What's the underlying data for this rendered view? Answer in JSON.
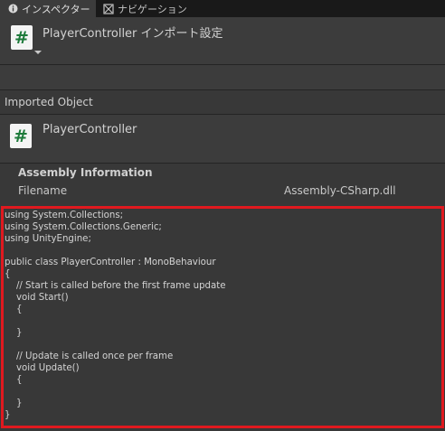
{
  "tabs": [
    {
      "label": "インスペクター",
      "icon": "info-icon",
      "active": true
    },
    {
      "label": "ナビゲーション",
      "icon": "navigation-icon",
      "active": false
    }
  ],
  "header": {
    "title": "PlayerController インポート設定",
    "icon": "csharp-script-icon"
  },
  "imported": {
    "section_label": "Imported Object",
    "name": "PlayerController",
    "icon": "csharp-script-icon"
  },
  "assembly": {
    "title": "Assembly Information",
    "filename_label": "Filename",
    "filename_value": "Assembly-CSharp.dll"
  },
  "code": "using System.Collections;\nusing System.Collections.Generic;\nusing UnityEngine;\n\npublic class PlayerController : MonoBehaviour\n{\n    // Start is called before the first frame update\n    void Start()\n    {\n\n    }\n\n    // Update is called once per frame\n    void Update()\n    {\n\n    }\n}",
  "colors": {
    "highlight_border": "#e0191f",
    "script_icon_green": "#1d7a3a"
  }
}
